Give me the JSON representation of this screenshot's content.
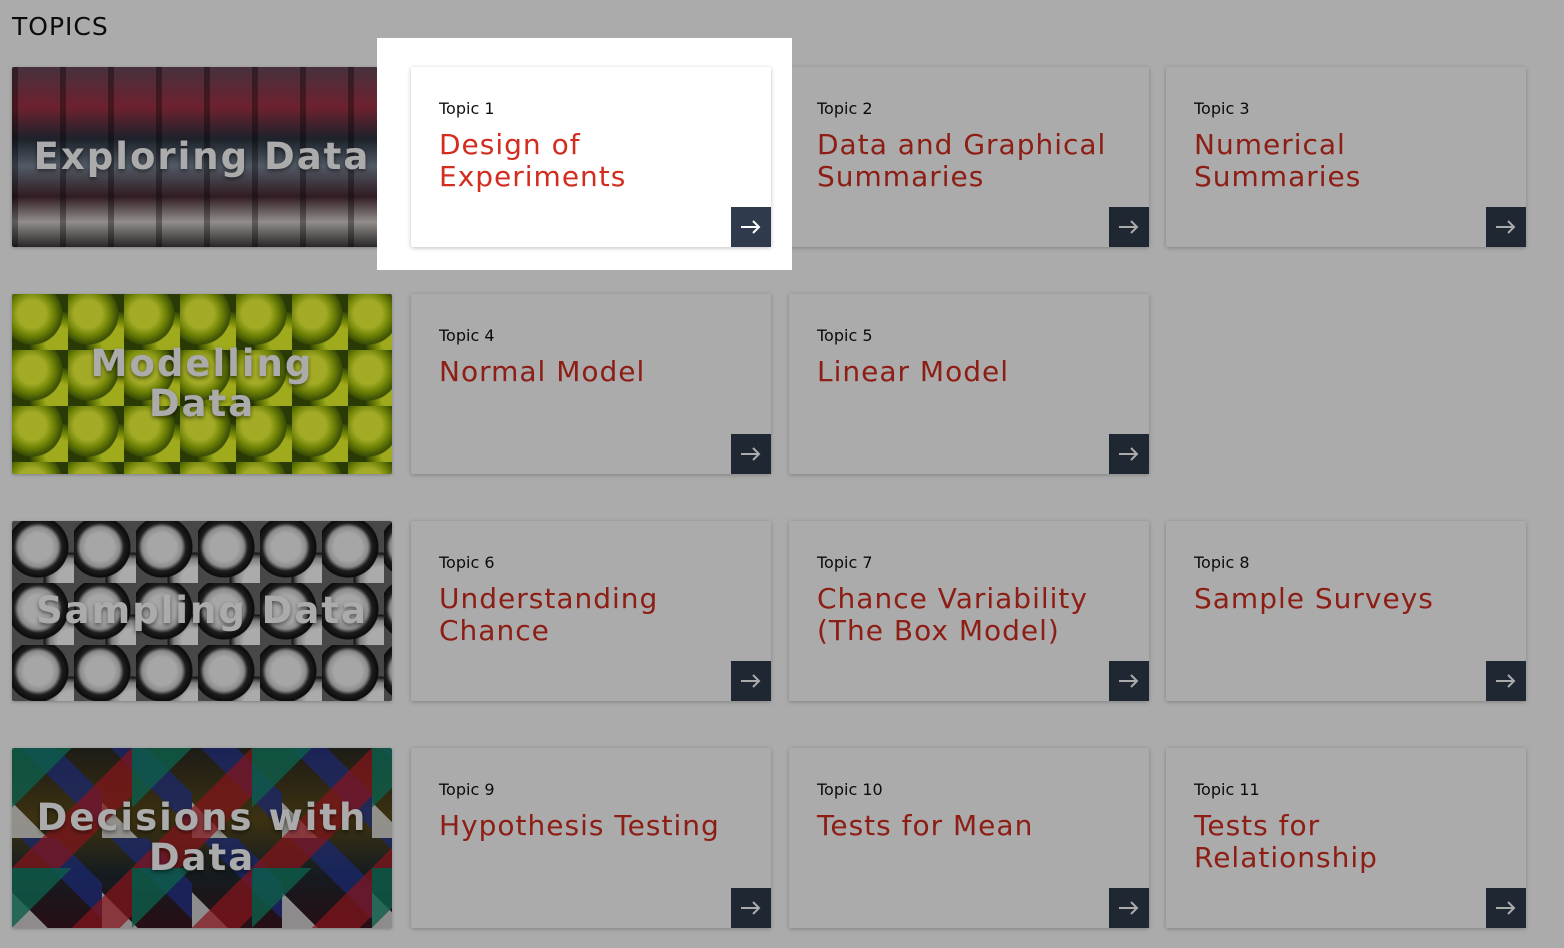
{
  "page": {
    "title": "TOPICS"
  },
  "categories": [
    {
      "label": "Exploring Data"
    },
    {
      "label": "Modelling Data"
    },
    {
      "label": "Sampling Data"
    },
    {
      "label": "Decisions with Data"
    }
  ],
  "topics": [
    {
      "number": "Topic 1",
      "title": "Design of Experiments"
    },
    {
      "number": "Topic 2",
      "title": "Data and Graphical Summaries"
    },
    {
      "number": "Topic 3",
      "title": "Numerical Summaries"
    },
    {
      "number": "Topic 4",
      "title": "Normal Model"
    },
    {
      "number": "Topic 5",
      "title": "Linear Model"
    },
    {
      "number": "Topic 6",
      "title": "Understanding Chance"
    },
    {
      "number": "Topic 7",
      "title": "Chance Variability (The Box Model)"
    },
    {
      "number": "Topic 8",
      "title": "Sample Surveys"
    },
    {
      "number": "Topic 9",
      "title": "Hypothesis Testing"
    },
    {
      "number": "Topic 10",
      "title": "Tests for Mean"
    },
    {
      "number": "Topic 11",
      "title": "Tests for Relationship"
    }
  ],
  "colors": {
    "accent": "#d32d20",
    "button": "#2f3b4c",
    "dim_overlay": "rgba(0,0,0,0.33)"
  },
  "icons": {
    "card_button": "arrow-right-icon"
  },
  "highlighted_topic": "Topic 1"
}
